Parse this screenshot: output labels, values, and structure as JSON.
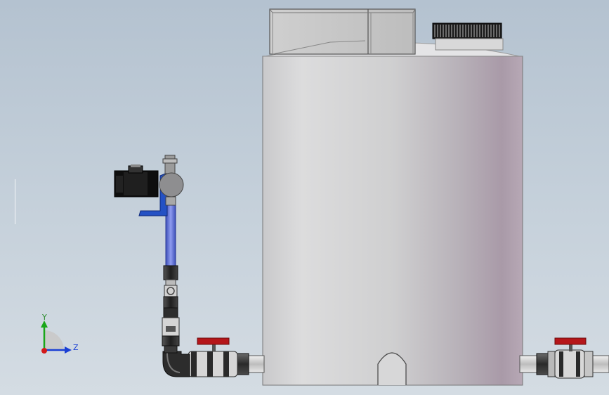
{
  "viewport": {
    "background_top": "#b4c2d0",
    "background_bottom": "#d4dce3"
  },
  "triad": {
    "y_label": "Y",
    "z_label": "Z",
    "y_color": "#19a619",
    "z_color": "#1a3fd4",
    "x_color": "#d21a1a"
  },
  "colors": {
    "tank_body": "#cdcbce",
    "tank_shadow": "#a99aa8",
    "motor": "#111111",
    "pump_bracket": "#2455c8",
    "suction_tube": "#5a6fd8",
    "valve_handle": "#c01818",
    "pipe": "#3a3a3a"
  },
  "icons": [
    "coordinate-triad-icon"
  ]
}
